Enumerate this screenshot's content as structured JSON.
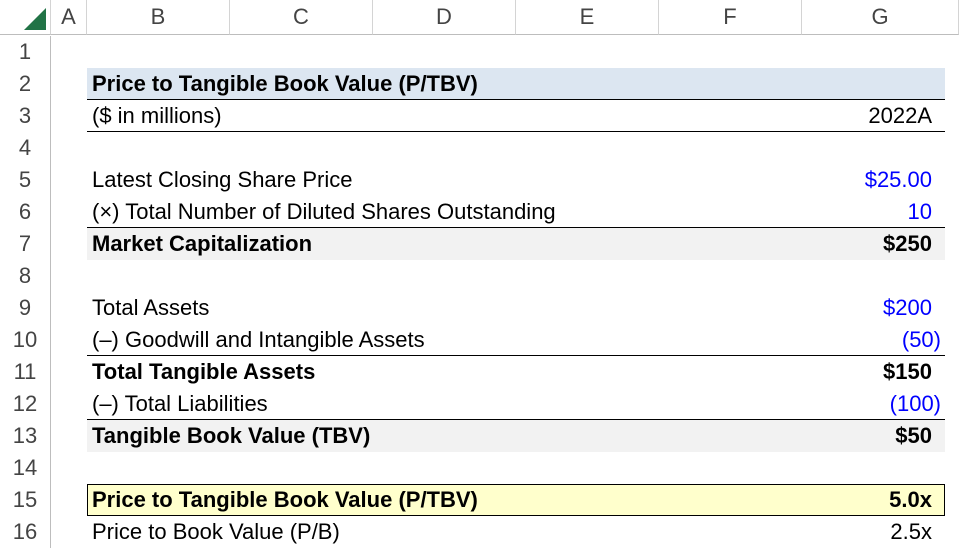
{
  "columns": [
    "A",
    "B",
    "C",
    "D",
    "E",
    "F",
    "G"
  ],
  "row_numbers": [
    "1",
    "2",
    "3",
    "4",
    "5",
    "6",
    "7",
    "8",
    "9",
    "10",
    "11",
    "12",
    "13",
    "14",
    "15",
    "16"
  ],
  "title": "Price to Tangible Book Value (P/TBV)",
  "units_label": "($ in millions)",
  "year_label": "2022A",
  "rows": {
    "share_price": {
      "label": "Latest Closing Share Price",
      "value": "$25.00"
    },
    "diluted_shares": {
      "label": "(×) Total Number of Diluted Shares Outstanding",
      "value": "10"
    },
    "market_cap": {
      "label": "Market Capitalization",
      "value": "$250"
    },
    "total_assets": {
      "label": "Total Assets",
      "value": "$200"
    },
    "goodwill": {
      "label": "(–) Goodwill and Intangible Assets",
      "value": "(50)"
    },
    "tangible_assets": {
      "label": "Total Tangible Assets",
      "value": "$150"
    },
    "liabilities": {
      "label": "(–) Total Liabilities",
      "value": "(100)"
    },
    "tbv": {
      "label": "Tangible Book Value (TBV)",
      "value": "$50"
    },
    "ptbv": {
      "label": "Price to Tangible Book Value (P/TBV)",
      "value": "5.0x"
    },
    "pb": {
      "label": "Price to Book Value (P/B)",
      "value": "2.5x"
    }
  },
  "colors": {
    "input_blue": "#0000ff",
    "title_fill": "#dce6f1",
    "total_fill": "#f2f2f2",
    "highlight_fill": "#ffffcc"
  }
}
